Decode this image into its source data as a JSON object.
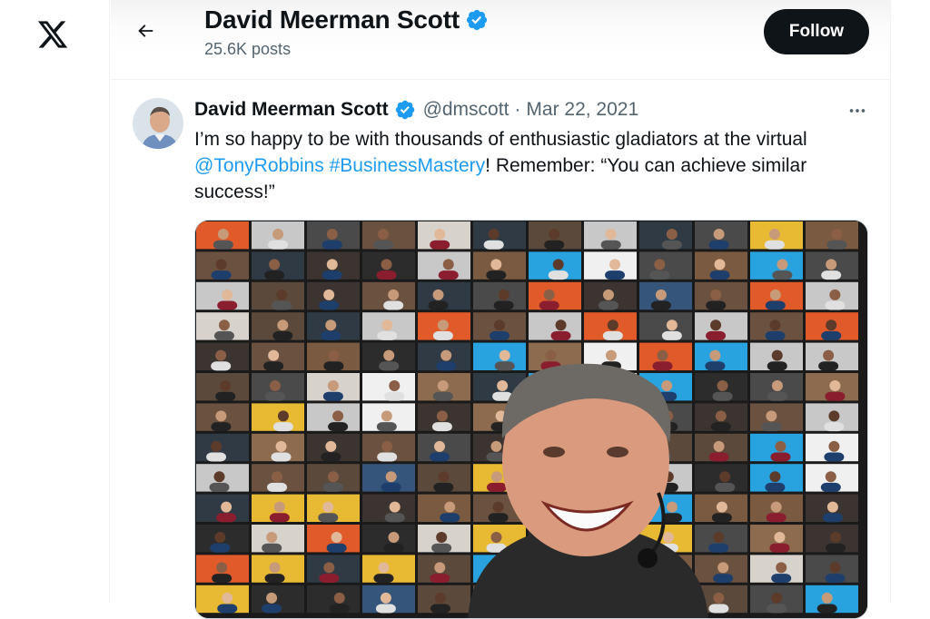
{
  "nav": {
    "logo_icon": "x-logo-icon"
  },
  "header": {
    "back_icon": "arrow-left-icon",
    "name": "David Meerman Scott",
    "verified_icon": "verified-badge-icon",
    "post_count": "25.6K posts",
    "follow_label": "Follow"
  },
  "tweet": {
    "author_name": "David Meerman Scott",
    "handle": "@dmscott",
    "separator": "·",
    "date": "Mar 22, 2021",
    "more_icon": "more-horizontal-icon",
    "text_before": "I’m so happy to be with thousands of enthusiastic gladiators at the virtual ",
    "mention": "@TonyRobbins",
    "space": " ",
    "hashtag": "#BusinessMastery",
    "text_after": "! Remember: “You can achieve similar success!”",
    "media_description_icon": "photo-video-grid-selfie"
  },
  "colors": {
    "brand_blue": "#1d9bf0",
    "text_primary": "#0f1419",
    "text_secondary": "#536471",
    "follow_bg": "#0f1419"
  }
}
